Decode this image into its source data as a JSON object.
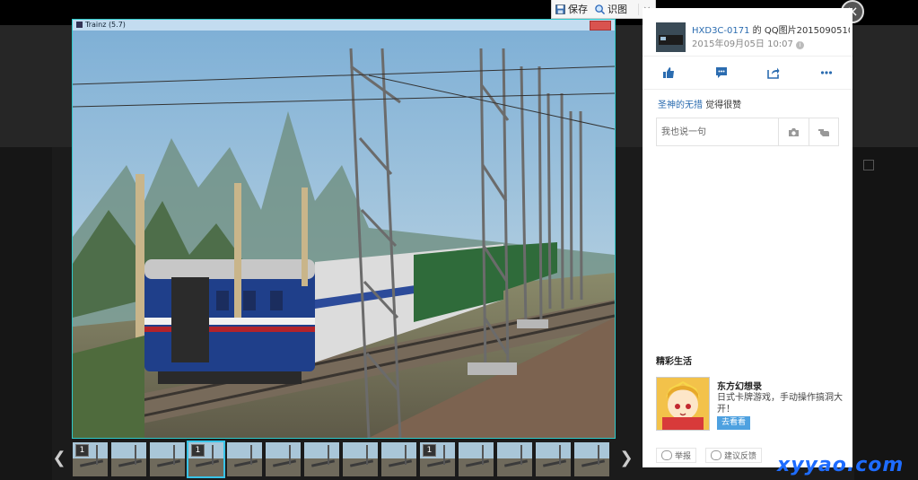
{
  "toolbar": {
    "save_label": "保存",
    "recognize_label": "识图",
    "close_glyph": "×"
  },
  "photo": {
    "window_title": "Trainz  (5.7)"
  },
  "panel": {
    "author": "HXD3C-0171",
    "author_suffix": " 的 ",
    "photo_name": "QQ图片2015090510...",
    "date": "2015年09月05日  10:07",
    "info_glyph": "i",
    "liker": "圣神的无措",
    "likes_suffix": " 觉得很赞",
    "comment_placeholder": "我也说一句",
    "life_title": "精彩生活",
    "ad_title": "东方幻想录",
    "ad_desc": "日式卡牌游戏，手动操作搞洞大开！",
    "ad_button": "去看看",
    "report_label": "举报",
    "feedback_label": "建议反馈"
  },
  "thumbs": {
    "items": [
      {
        "badge": "1"
      },
      {
        "badge": ""
      },
      {
        "badge": ""
      },
      {
        "badge": "1"
      },
      {
        "badge": ""
      },
      {
        "badge": ""
      },
      {
        "badge": ""
      },
      {
        "badge": ""
      },
      {
        "badge": ""
      },
      {
        "badge": "1"
      },
      {
        "badge": ""
      },
      {
        "badge": ""
      },
      {
        "badge": ""
      },
      {
        "badge": ""
      }
    ],
    "active_index": 3,
    "prev_glyph": "❮",
    "next_glyph": "❯"
  },
  "close_glyph": "×",
  "watermark": "xyyao.com",
  "colors": {
    "accent": "#38c4e8",
    "link": "#2b6cb0",
    "ad_button": "#4ea1e0",
    "watermark": "#1e6cff"
  },
  "icons": [
    "save-icon",
    "recognize-icon",
    "thumbs-up-icon",
    "comment-icon",
    "share-icon",
    "more-icon",
    "camera-icon",
    "hand-icon",
    "report-icon",
    "feedback-icon",
    "info-icon"
  ]
}
